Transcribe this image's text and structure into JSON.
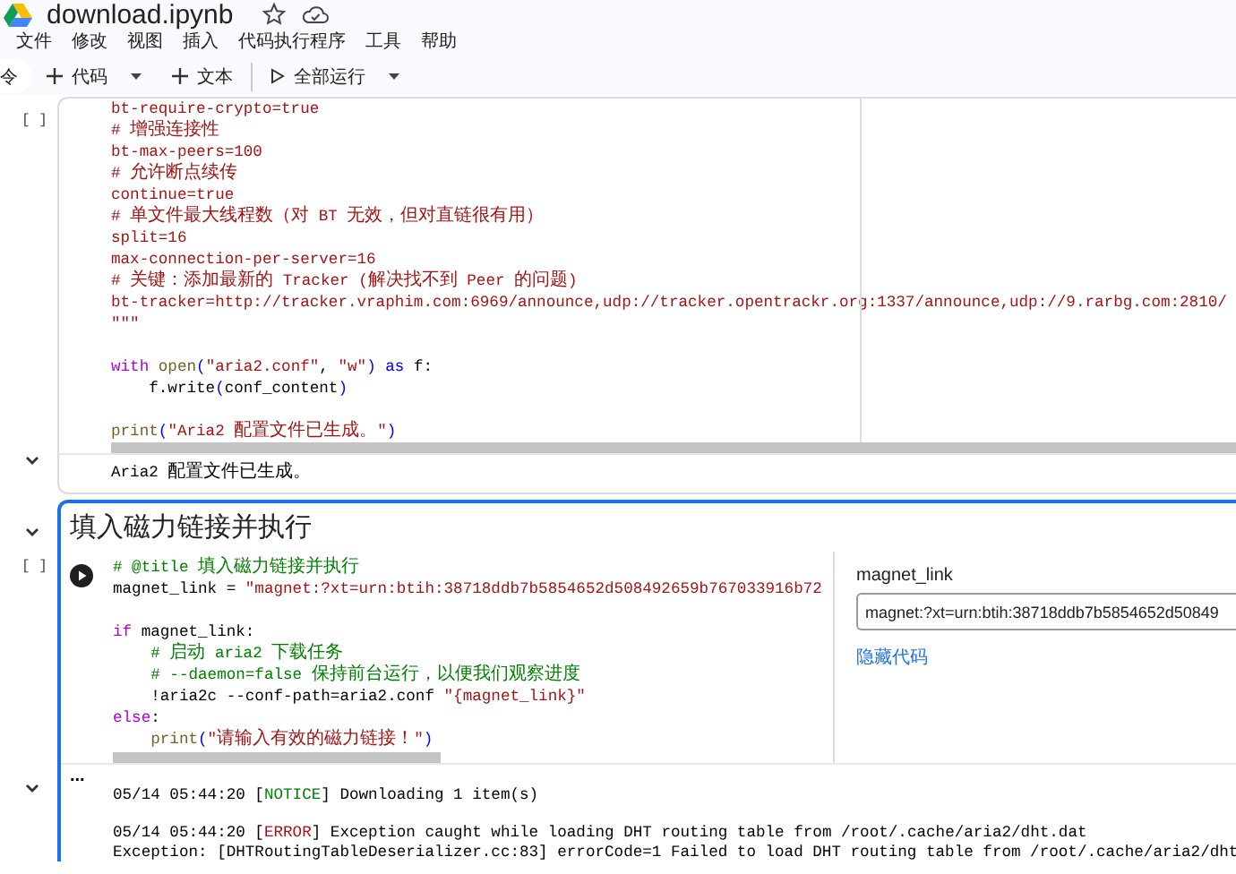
{
  "file": {
    "name": "download.ipynb"
  },
  "menu": [
    "文件",
    "修改",
    "视图",
    "插入",
    "代码执行程序",
    "工具",
    "帮助"
  ],
  "toolbar": [
    {
      "kind": "partial",
      "label": "令"
    },
    {
      "kind": "add",
      "label": "代码",
      "caret": true
    },
    {
      "kind": "add",
      "label": "文本",
      "caret": false
    },
    {
      "kind": "run",
      "label": "全部运行",
      "caret": true
    }
  ],
  "cells": [
    {
      "kind": "code",
      "focused": false,
      "exec": "[ ]",
      "lines": [
        {
          "kind": "code",
          "tokens": [
            {
              "text": "bt-require-crypto=true",
              "kind": "string"
            }
          ]
        },
        {
          "kind": "code",
          "tokens": [
            {
              "text": "# 增强连接性",
              "kind": "string"
            }
          ]
        },
        {
          "kind": "code",
          "tokens": [
            {
              "text": "bt-max-peers=100",
              "kind": "string"
            }
          ]
        },
        {
          "kind": "code",
          "tokens": [
            {
              "text": "# 允许断点续传",
              "kind": "string"
            }
          ]
        },
        {
          "kind": "code",
          "tokens": [
            {
              "text": "continue=true",
              "kind": "string"
            }
          ]
        },
        {
          "kind": "code",
          "tokens": [
            {
              "text": "# 单文件最大线程数（对 BT 无效，但对直链很有用）",
              "kind": "string"
            }
          ]
        },
        {
          "kind": "code",
          "tokens": [
            {
              "text": "split=16",
              "kind": "string"
            }
          ]
        },
        {
          "kind": "code",
          "tokens": [
            {
              "text": "max-connection-per-server=16",
              "kind": "string"
            }
          ]
        },
        {
          "kind": "code",
          "tokens": [
            {
              "text": "# 关键：添加最新的 Tracker (解决找不到 Peer 的问题)",
              "kind": "string"
            }
          ]
        },
        {
          "kind": "code",
          "tokens": [
            {
              "text": "bt-tracker=http://tracker.vraphim.com:6969/announce,udp://tracker.opentrackr.org:1337/announce,udp://9.rarbg.com:2810/",
              "kind": "string"
            }
          ]
        },
        {
          "kind": "code",
          "tokens": [
            {
              "text": "\"\"\"",
              "kind": "string"
            }
          ]
        },
        {
          "kind": "blank"
        },
        {
          "kind": "code",
          "tokens": [
            {
              "text": "with",
              "kind": "control"
            },
            {
              "text": " open",
              "kind": "builtin"
            },
            {
              "text": "(",
              "kind": "keyword"
            },
            {
              "text": "\"aria2.conf\"",
              "kind": "string"
            },
            {
              "text": ", ",
              "kind": "plain"
            },
            {
              "text": "\"w\"",
              "kind": "string"
            },
            {
              "text": ")",
              "kind": "keyword"
            },
            {
              "text": " as",
              "kind": "keyword"
            },
            {
              "text": " f:",
              "kind": "plain"
            }
          ]
        },
        {
          "kind": "code",
          "tokens": [
            {
              "text": "    f.write",
              "kind": "plain"
            },
            {
              "text": "(",
              "kind": "keyword"
            },
            {
              "text": "conf_content",
              "kind": "plain"
            },
            {
              "text": ")",
              "kind": "keyword"
            }
          ]
        },
        {
          "kind": "blank"
        },
        {
          "kind": "code",
          "tokens": [
            {
              "text": "print",
              "kind": "builtin"
            },
            {
              "text": "(",
              "kind": "keyword"
            },
            {
              "text": "\"Aria2 配置文件已生成。\"",
              "kind": "string"
            },
            {
              "text": ")",
              "kind": "keyword"
            }
          ]
        }
      ],
      "output": {
        "expanded": true,
        "lines": [
          {
            "kind": "code",
            "tokens": [
              {
                "text": "Aria2 配置文件已生成。",
                "kind": "plain"
              }
            ]
          }
        ]
      }
    },
    {
      "kind": "form",
      "focused": true,
      "title": "填入磁力链接并执行",
      "expanded": true,
      "exec": "[ ]",
      "lines": [
        {
          "kind": "code",
          "tokens": [
            {
              "text": "# @title 填入磁力链接并执行",
              "kind": "comment"
            }
          ]
        },
        {
          "kind": "code",
          "tokens": [
            {
              "text": "magnet_link = ",
              "kind": "plain"
            },
            {
              "text": "\"magnet:?xt=urn:btih:38718ddb7b5854652d508492659b767033916b72",
              "kind": "string"
            }
          ]
        },
        {
          "kind": "blank"
        },
        {
          "kind": "code",
          "tokens": [
            {
              "text": "if",
              "kind": "control"
            },
            {
              "text": " magnet_link:",
              "kind": "plain"
            }
          ]
        },
        {
          "kind": "code",
          "tokens": [
            {
              "text": "    # 启动 aria2 下载任务",
              "kind": "comment"
            }
          ]
        },
        {
          "kind": "code",
          "tokens": [
            {
              "text": "    # --daemon=false 保持前台运行，以便我们观察进度",
              "kind": "comment"
            }
          ]
        },
        {
          "kind": "code",
          "tokens": [
            {
              "text": "    !aria2c --conf-path=aria2.conf ",
              "kind": "plain"
            },
            {
              "text": "\"{magnet_link}\"",
              "kind": "string"
            }
          ]
        },
        {
          "kind": "code",
          "tokens": [
            {
              "text": "else",
              "kind": "control"
            },
            {
              "text": ":",
              "kind": "plain"
            }
          ]
        },
        {
          "kind": "code",
          "tokens": [
            {
              "text": "    print",
              "kind": "builtin"
            },
            {
              "text": "(",
              "kind": "keyword"
            },
            {
              "text": "\"请输入有效的磁力链接！\"",
              "kind": "string"
            },
            {
              "text": ")",
              "kind": "keyword"
            }
          ]
        }
      ],
      "form": {
        "field_label": "magnet_link",
        "value": "magnet:?xt=urn:btih:38718ddb7b5854652d50849",
        "link": "隐藏代码"
      },
      "output": {
        "expanded": true,
        "status": "...",
        "lines": [
          {
            "kind": "code",
            "tokens": [
              {
                "text": "05/14 05:44:20 [",
                "kind": "plain"
              },
              {
                "text": "NOTICE",
                "kind": "notice"
              },
              {
                "text": "] Downloading 1 item(s)",
                "kind": "plain"
              }
            ]
          },
          {
            "kind": "blank"
          },
          {
            "kind": "code",
            "tokens": [
              {
                "text": "05/14 05:44:20 [",
                "kind": "plain"
              },
              {
                "text": "ERROR",
                "kind": "error"
              },
              {
                "text": "] Exception caught while loading DHT routing table from /root/.cache/aria2/dht.dat",
                "kind": "plain"
              }
            ]
          },
          {
            "kind": "code",
            "tokens": [
              {
                "text": "Exception: [DHTRoutingTableDeserializer.cc:83] errorCode=1 Failed to load DHT routing table from /root/.cache/aria2/dht",
                "kind": "plain"
              }
            ]
          }
        ]
      }
    }
  ]
}
